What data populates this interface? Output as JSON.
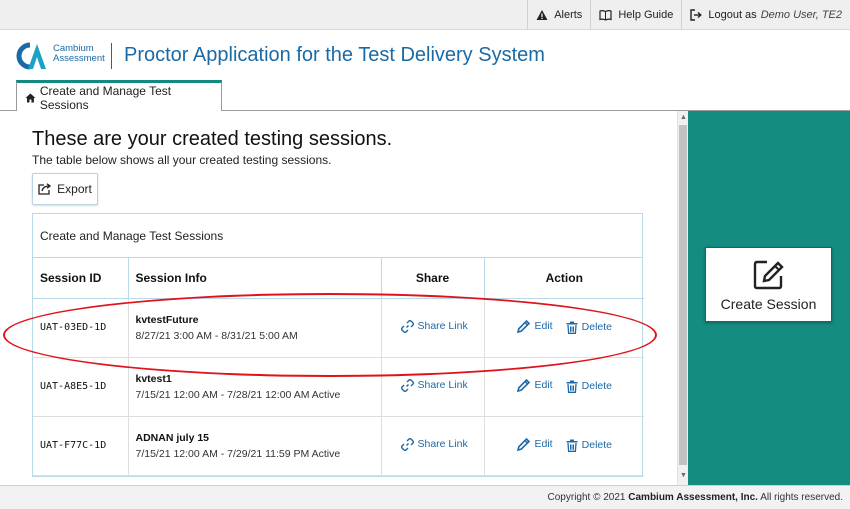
{
  "topbar": {
    "alerts": "Alerts",
    "help": "Help Guide",
    "logout": "Logout as",
    "user": "Demo User, TE2"
  },
  "header": {
    "logo_line1": "Cambium",
    "logo_line2": "Assessment",
    "app_title": "Proctor Application for the Test Delivery System"
  },
  "tab": {
    "label": "Create and Manage Test Sessions"
  },
  "main": {
    "title": "These are your created testing sessions.",
    "subtitle": "The table below shows all your created testing sessions.",
    "export_label": "Export",
    "table": {
      "caption": "Create and Manage Test Sessions",
      "headers": {
        "session_id": "Session ID",
        "session_info": "Session Info",
        "share": "Share",
        "action": "Action"
      },
      "share_label": "Share Link",
      "edit_label": "Edit",
      "delete_label": "Delete",
      "rows": [
        {
          "id": "UAT-03ED-1D",
          "name": "kvtestFuture",
          "dates": "8/27/21 3:00 AM - 8/31/21 5:00 AM"
        },
        {
          "id": "UAT-A8E5-1D",
          "name": "kvtest1",
          "dates": "7/15/21 12:00 AM - 7/28/21 12:00 AM Active"
        },
        {
          "id": "UAT-F77C-1D",
          "name": "ADNAN july 15",
          "dates": "7/15/21 12:00 AM - 7/29/21 11:59 PM Active"
        }
      ]
    }
  },
  "side": {
    "create_label": "Create Session"
  },
  "footer": {
    "prefix": "Copyright © 2021",
    "company": "Cambium Assessment, Inc.",
    "suffix": "All rights reserved."
  },
  "colors": {
    "brand_blue": "#1b6aa5",
    "teal": "#148c80",
    "highlight_red": "#e0131a",
    "link_blue": "#1d69a8"
  }
}
